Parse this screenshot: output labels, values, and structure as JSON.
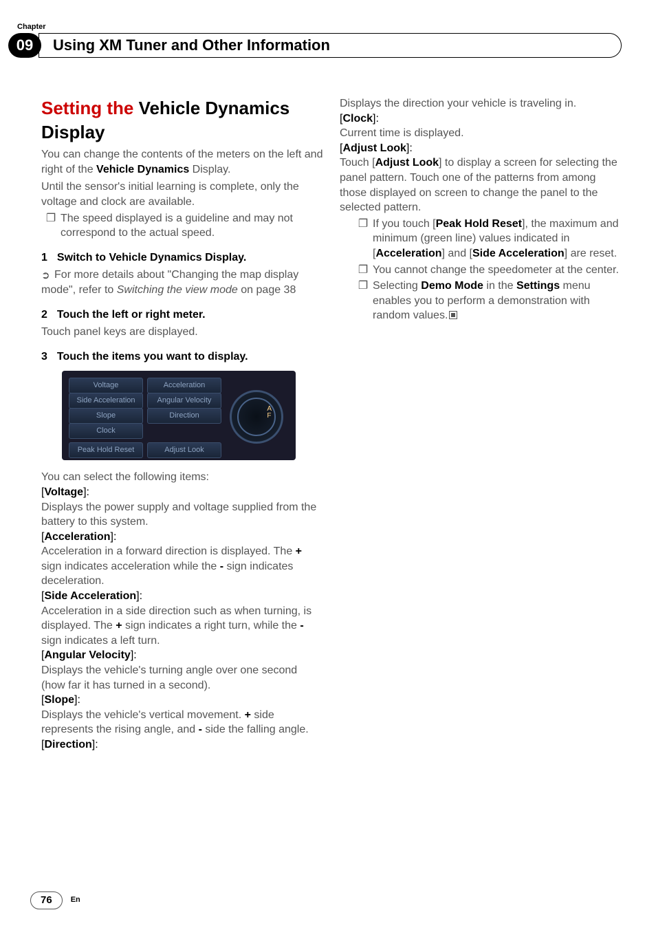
{
  "chapter_label": "Chapter",
  "chapter_num": "09",
  "header_title": "Using XM Tuner and Other Information",
  "left": {
    "h_red": "Setting the ",
    "h_semibold": "Vehicle Dynamics Display",
    "intro1": "You can change the contents of the meters on the left and right of the ",
    "intro1_bold": "Vehicle Dynamics",
    "intro1_tail": " Display.",
    "intro2": "Until the sensor's initial learning is complete, only the voltage and clock are available.",
    "bullet1": "The speed displayed is a guideline and may not correspond to the actual speed.",
    "step1_num": "1",
    "step1_title": "Switch to Vehicle Dynamics Display.",
    "supset_lead": "For more details about \"Changing the map display mode\", refer to ",
    "supset_ital": "Switching the view mode",
    "supset_tail": " on page 38",
    "step2_num": "2",
    "step2_title": "Touch the left or right meter.",
    "step2_body": "Touch panel keys are displayed.",
    "step3_num": "3",
    "step3_title": "Touch the items you want to display.",
    "ss": {
      "voltage": "Voltage",
      "accel": "Acceleration",
      "sideaccel": "Side Acceleration",
      "angvel": "Angular Velocity",
      "slope": "Slope",
      "direction": "Direction",
      "clock": "Clock",
      "peak": "Peak Hold Reset",
      "adjust": "Adjust Look"
    },
    "afterss_lead": "You can select the following items:",
    "items": {
      "voltage_label": "Voltage",
      "voltage_body": "Displays the power supply and voltage supplied from the battery to this system.",
      "accel_label": "Acceleration",
      "accel_body1": "Acceleration in a forward direction is displayed. The ",
      "accel_plus": "+",
      "accel_body2": " sign indicates acceleration while the ",
      "accel_minus": "-",
      "accel_body3": " sign indicates deceleration.",
      "sideaccel_label": "Side Acceleration",
      "sideaccel_body1": "Acceleration in a side direction such as when turning, is displayed. The ",
      "sideaccel_body2": " sign indicates a right turn, while the ",
      "sideaccel_body3": " sign indicates a left turn.",
      "angvel_label": "Angular Velocity",
      "angvel_body": "Displays the vehicle's turning angle over one second (how far it has turned in a second).",
      "slope_label": "Slope",
      "slope_body1": "Displays the vehicle's vertical movement. ",
      "slope_body2": " side represents the rising angle, and ",
      "slope_body3": " side the falling angle.",
      "direction_label": "Direction"
    }
  },
  "right": {
    "dir_body": "Displays the direction your vehicle is traveling in.",
    "clock_label": "Clock",
    "clock_body": "Current time is displayed.",
    "adjust_label": "Adjust Look",
    "adjust_body1": "Touch [",
    "adjust_bold": "Adjust Look",
    "adjust_body2": "] to display a screen for selecting the panel pattern. Touch one of the patterns from among those displayed on screen to change the panel to the selected pattern.",
    "b1_a": "If you touch [",
    "b1_peak": "Peak Hold Reset",
    "b1_b": "], the maximum and minimum (green line) values indicated in [",
    "b1_accel": "Acceleration",
    "b1_c": "] and [",
    "b1_side": "Side Acceleration",
    "b1_d": "] are reset.",
    "b2": "You cannot change the speedometer at the center.",
    "b3_a": "Selecting ",
    "b3_demo": "Demo Mode",
    "b3_b": " in the ",
    "b3_settings": "Settings",
    "b3_c": " menu enables you to perform a demonstration with random values."
  },
  "footer": {
    "page": "76",
    "lang": "En"
  }
}
